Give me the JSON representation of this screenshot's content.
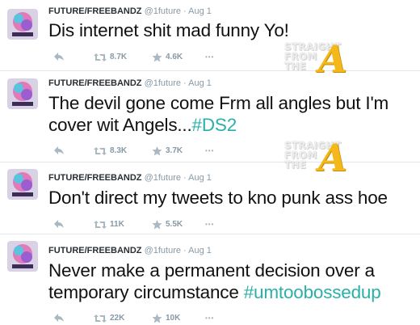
{
  "tweets": [
    {
      "name": "FUTURE/FREEBANDZ",
      "handle": "@1future",
      "separator": "·",
      "date": "Aug 1",
      "text": "Dis internet shit mad funny Yo!",
      "hashtag": "",
      "retweets": "8.7K",
      "favorites": "4.6K",
      "more": "•••"
    },
    {
      "name": "FUTURE/FREEBANDZ",
      "handle": "@1future",
      "separator": "·",
      "date": "Aug 1",
      "text": "The devil gone come Frm all angles but I'm cover wit Angels...",
      "hashtag": "#DS2",
      "retweets": "8.3K",
      "favorites": "3.7K",
      "more": "•••"
    },
    {
      "name": "FUTURE/FREEBANDZ",
      "handle": "@1future",
      "separator": "·",
      "date": "Aug 1",
      "text": "Don't direct my tweets to kno punk ass hoe",
      "hashtag": "",
      "retweets": "11K",
      "favorites": "5.5K",
      "more": "•••"
    },
    {
      "name": "FUTURE/FREEBANDZ",
      "handle": "@1future",
      "separator": "·",
      "date": "Aug 1",
      "text": "Never make a permanent decision over a temporary circumstance ",
      "hashtag": "#umtoobossedup",
      "retweets": "22K",
      "favorites": "10K",
      "more": "•••"
    }
  ],
  "watermark": {
    "line1": "STRAIGHT",
    "line2": "FROM",
    "line3": "THE",
    "letter": "A"
  },
  "colors": {
    "hashtag": "#2bb0a8",
    "meta": "#8899a6",
    "watermark_letter": "#f4b81b"
  },
  "icons": {
    "avatar": "album-cover-avatar",
    "reply": "reply-icon",
    "retweet": "retweet-icon",
    "favorite": "star-icon",
    "more": "more-icon"
  }
}
